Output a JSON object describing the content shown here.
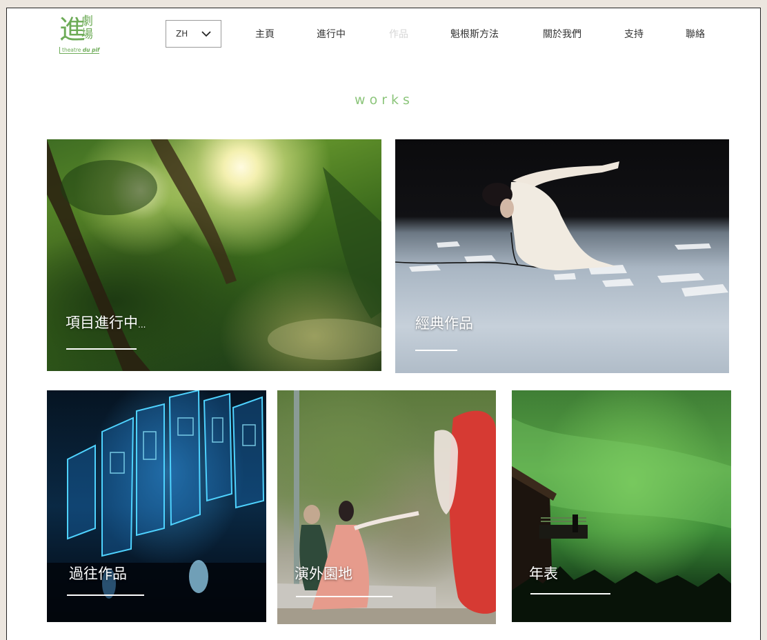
{
  "logo": {
    "big_char": "進",
    "small_char_1": "劇",
    "small_char_2": "場",
    "subtitle_1": "theatre",
    "subtitle_2": "du pif"
  },
  "language_selector": {
    "value": "ZH",
    "icon": "chevron-down-icon"
  },
  "nav": {
    "items": [
      {
        "label": "主頁",
        "active": false
      },
      {
        "label": "進行中",
        "active": false
      },
      {
        "label": "作品",
        "active": true
      },
      {
        "label": "魁根斯方法",
        "active": false
      },
      {
        "label": "關於我們",
        "active": false
      },
      {
        "label": "支持",
        "active": false
      },
      {
        "label": "聯絡",
        "active": false
      }
    ]
  },
  "page": {
    "title": "works"
  },
  "tiles": [
    {
      "label": "項目進行中",
      "ellipsis": "..."
    },
    {
      "label": "經典作品"
    },
    {
      "label": "過往作品"
    },
    {
      "label": "演外園地"
    },
    {
      "label": "年表"
    }
  ],
  "colors": {
    "brand_green": "#6dab57",
    "title_green": "#8cc57b",
    "active_nav": "#d6d6d6",
    "text": "#333333",
    "background": "#ece6df"
  }
}
